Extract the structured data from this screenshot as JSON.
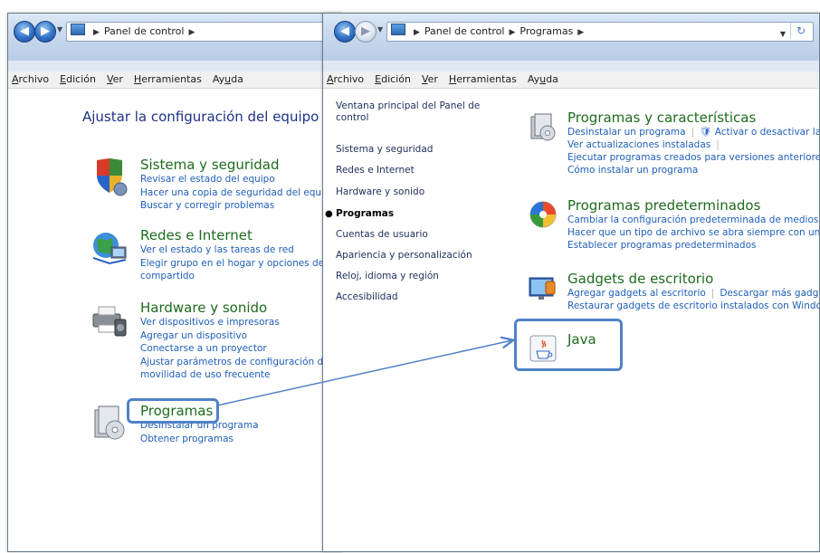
{
  "left_window": {
    "address": [
      "Panel de control"
    ],
    "menu": [
      {
        "label": "Archivo",
        "u": "A"
      },
      {
        "label": "Edición",
        "u": "E"
      },
      {
        "label": "Ver",
        "u": "V"
      },
      {
        "label": "Herramientas",
        "u": "H"
      },
      {
        "label": "Ayuda",
        "u": "u"
      }
    ],
    "heading": "Ajustar la configuración del equipo",
    "categories": [
      {
        "title": "Sistema y seguridad",
        "icon": "shield-icon",
        "links": [
          "Revisar el estado del equipo",
          "Hacer una copia de seguridad del equipo",
          "Buscar y corregir problemas"
        ]
      },
      {
        "title": "Redes e Internet",
        "icon": "network-globe-icon",
        "links": [
          "Ver el estado y las tareas de red",
          "Elegir grupo en el hogar y opciones de uso",
          "compartido"
        ]
      },
      {
        "title": "Hardware y sonido",
        "icon": "printer-speaker-icon",
        "links": [
          "Ver dispositivos e impresoras",
          "Agregar un dispositivo",
          "Conectarse a un proyector",
          "Ajustar parámetros de configuración de",
          "movilidad de uso frecuente"
        ]
      },
      {
        "title": "Programas",
        "icon": "programs-icon",
        "links": [
          "Desinstalar un programa",
          "Obtener programas"
        ]
      }
    ]
  },
  "right_window": {
    "address": [
      "Panel de control",
      "Programas"
    ],
    "menu": [
      {
        "label": "Archivo",
        "u": "A"
      },
      {
        "label": "Edición",
        "u": "E"
      },
      {
        "label": "Ver",
        "u": "V"
      },
      {
        "label": "Herramientas",
        "u": "H"
      },
      {
        "label": "Ayuda",
        "u": "u"
      }
    ],
    "sidebar": [
      "Ventana principal del Panel de control",
      "Sistema y seguridad",
      "Redes e Internet",
      "Hardware y sonido",
      "Programas",
      "Cuentas de usuario",
      "Apariencia y personalización",
      "Reloj, idioma y región",
      "Accesibilidad"
    ],
    "categories": [
      {
        "title": "Programas y características",
        "icon": "programs-features-icon",
        "links": [
          "Desinstalar un programa",
          "Activar o desactivar las características de Windows",
          "Ver actualizaciones instaladas",
          "Ejecutar programas creados para versiones anteriores de Windows",
          "Cómo instalar un programa"
        ]
      },
      {
        "title": "Programas predeterminados",
        "icon": "default-programs-icon",
        "links": [
          "Cambiar la configuración predeterminada de medios o dispositivos",
          "Hacer que un tipo de archivo se abra siempre con un programa específico",
          "Establecer programas predeterminados"
        ]
      },
      {
        "title": "Gadgets de escritorio",
        "icon": "desktop-gadgets-icon",
        "links": [
          "Agregar gadgets al escritorio",
          "Descargar más gadgets en línea",
          "Restaurar gadgets de escritorio instalados con Windows"
        ]
      },
      {
        "title": "Java",
        "icon": "java-icon",
        "links": []
      }
    ]
  },
  "colors": {
    "link": "#1f5fb8",
    "category_title": "#1e6b1e",
    "heading": "#1e3287",
    "highlight": "#4f82c6"
  }
}
